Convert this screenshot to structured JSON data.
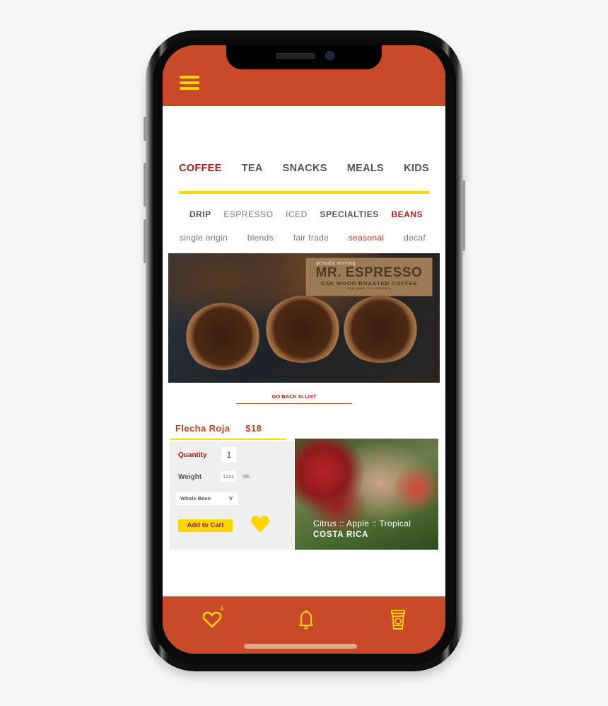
{
  "app": {
    "brand_color": "#c84a29",
    "accent_color": "#ffd600",
    "active_color": "#9c1d1d"
  },
  "header": {
    "menu_icon": "hamburger-menu-icon"
  },
  "main_tabs": [
    {
      "label": "COFFEE",
      "active": true
    },
    {
      "label": "TEA",
      "active": false
    },
    {
      "label": "SNACKS",
      "active": false
    },
    {
      "label": "MEALS",
      "active": false
    },
    {
      "label": "KIDS",
      "active": false
    }
  ],
  "sub_tabs": [
    {
      "label": "DRIP",
      "active": false
    },
    {
      "label": "ESPRESSO",
      "active": false
    },
    {
      "label": "ICED",
      "active": false
    },
    {
      "label": "SPECIALTIES",
      "active": false
    },
    {
      "label": "BEANS",
      "active": true
    }
  ],
  "filters": [
    {
      "label": "single origin",
      "active": false
    },
    {
      "label": "blends",
      "active": false
    },
    {
      "label": "fair trade",
      "active": false
    },
    {
      "label": "seasonal",
      "active": true
    },
    {
      "label": "decaf",
      "active": false
    }
  ],
  "hero": {
    "sign_tagline": "proudly serving",
    "sign_title": "MR. ESPRESSO",
    "sign_subtitle": "OAK WOOD ROASTED COFFEE",
    "sign_location": "OAKLAND CALIFORNIA"
  },
  "back_link": "GO BACK to LIST",
  "product": {
    "name": "Flecha Roja",
    "price": "$18",
    "quantity_label": "Quantity",
    "quantity_value": "1",
    "weight_label": "Weight",
    "weight_options": [
      "12oz",
      "5lb"
    ],
    "weight_selected": "12oz",
    "grind_selected": "Whole Bean",
    "grind_chevron": "V",
    "add_to_cart_label": "Add to Cart",
    "favorite_icon": "heart-filled-icon",
    "tasting_notes": "Citrus :: Apple :: Tropical",
    "origin": "COSTA RICA"
  },
  "bottom_nav": {
    "favorites_count": "4",
    "items": [
      "favorites-heart-icon",
      "notifications-bell-icon",
      "coffee-cup-icon"
    ]
  }
}
